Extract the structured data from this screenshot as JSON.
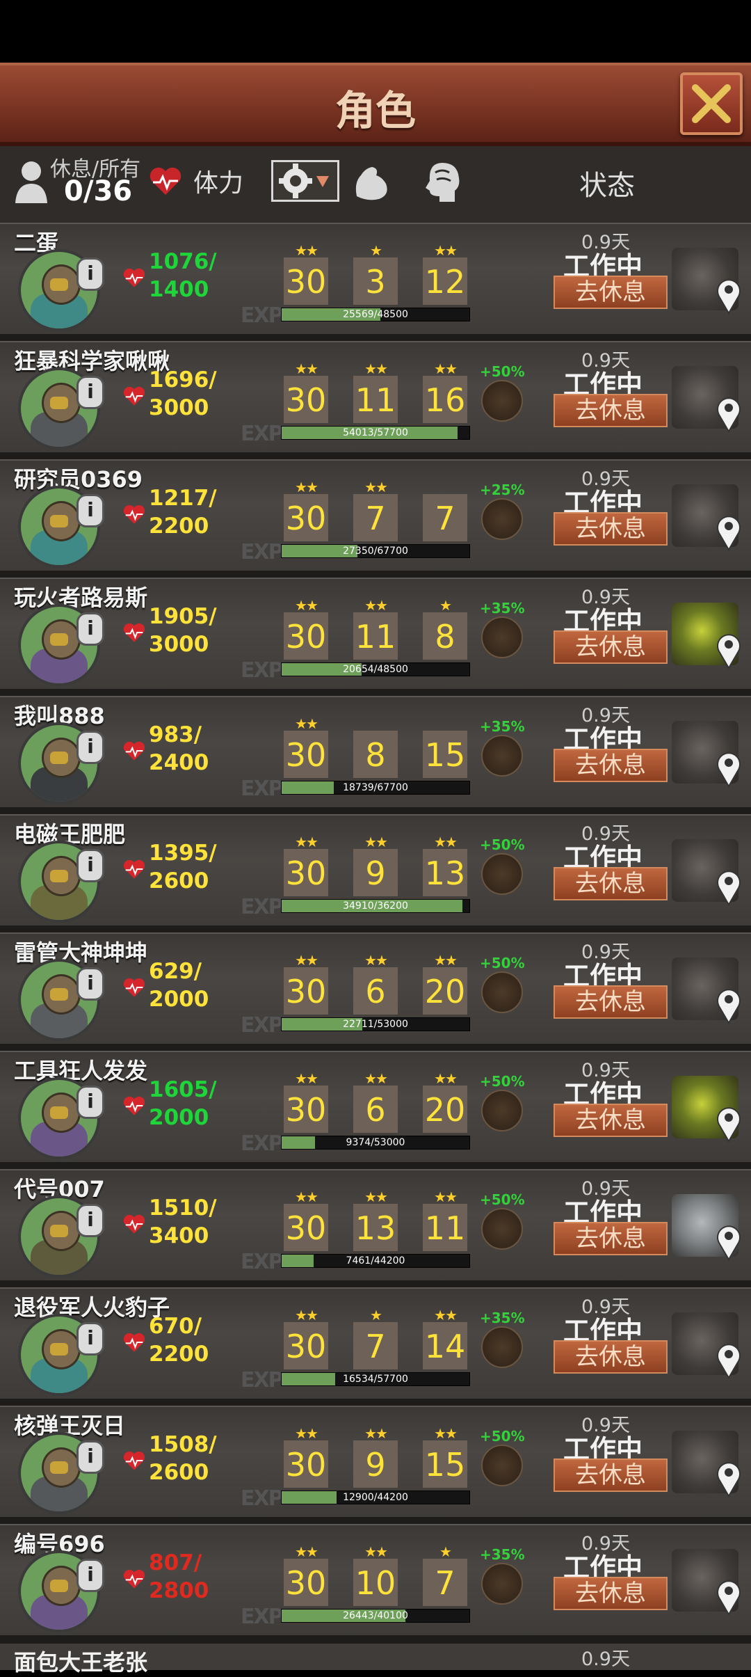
{
  "window": {
    "title": "角色",
    "close_icon": "close-icon"
  },
  "header": {
    "rest_label": "休息/所有",
    "rest_count": "0/36",
    "stamina_label": "体力",
    "status_label": "状态",
    "icons": [
      "person-icon",
      "heart-icon",
      "gear-sort-icon",
      "muscle-icon",
      "brain-icon"
    ]
  },
  "colors": {
    "hp_green": "#1fd63a",
    "hp_yellow": "#ffe23a",
    "hp_red": "#e02a1f",
    "exp_fill": "#6ea05a",
    "button": "#b5593a"
  },
  "characters": [
    {
      "name": "二蛋",
      "hp_cur": "1076/",
      "hp_max": "1400",
      "hp_color": "#1fd63a",
      "stat1": "30",
      "stat2": "3",
      "stat3": "12",
      "stars": [
        "★★",
        "★",
        "★★"
      ],
      "exp_text": "25569/48500",
      "exp_frac": 0.527,
      "bonus": "",
      "bonus_icon": "",
      "days": "0.9天",
      "status": "工作中",
      "action": "去休息",
      "machine": "machine-icon"
    },
    {
      "name": "狂暴科学家啾啾",
      "hp_cur": "1696/",
      "hp_max": "3000",
      "hp_color": "#ffe23a",
      "stat1": "30",
      "stat2": "11",
      "stat3": "16",
      "stars": [
        "★★",
        "★★",
        "★★"
      ],
      "exp_text": "54013/57700",
      "exp_frac": 0.936,
      "bonus": "+50%",
      "bonus_icon": "crystal-cluster-icon",
      "days": "0.9天",
      "status": "工作中",
      "action": "去休息",
      "machine": "machine-icon"
    },
    {
      "name": "研究员0369",
      "hp_cur": "1217/",
      "hp_max": "2200",
      "hp_color": "#ffe23a",
      "stat1": "30",
      "stat2": "7",
      "stat3": "7",
      "stars": [
        "★★",
        "★★",
        ""
      ],
      "exp_text": "27350/67700",
      "exp_frac": 0.404,
      "bonus": "+25%",
      "bonus_icon": "crystal-icon",
      "days": "0.9天",
      "status": "工作中",
      "action": "去休息",
      "machine": "machine-icon"
    },
    {
      "name": "玩火者路易斯",
      "hp_cur": "1905/",
      "hp_max": "3000",
      "hp_color": "#ffe23a",
      "stat1": "30",
      "stat2": "11",
      "stat3": "8",
      "stars": [
        "★★",
        "★★",
        "★"
      ],
      "exp_text": "20654/48500",
      "exp_frac": 0.426,
      "bonus": "+35%",
      "bonus_icon": "dynamite-icon",
      "days": "0.9天",
      "status": "工作中",
      "action": "去休息",
      "machine": "reactor-icon"
    },
    {
      "name": "我叫888",
      "hp_cur": "983/",
      "hp_max": "2400",
      "hp_color": "#ffe23a",
      "stat1": "30",
      "stat2": "8",
      "stat3": "15",
      "stars": [
        "★★",
        "",
        ""
      ],
      "exp_text": "18739/67700",
      "exp_frac": 0.277,
      "bonus": "+35%",
      "bonus_icon": "bottle-icon",
      "days": "0.9天",
      "status": "工作中",
      "action": "去休息",
      "machine": "machine-icon"
    },
    {
      "name": "电磁王肥肥",
      "hp_cur": "1395/",
      "hp_max": "2600",
      "hp_color": "#ffe23a",
      "stat1": "30",
      "stat2": "9",
      "stat3": "13",
      "stars": [
        "★★",
        "★★",
        "★★"
      ],
      "exp_text": "34910/36200",
      "exp_frac": 0.964,
      "bonus": "+50%",
      "bonus_icon": "orb-icon",
      "days": "0.9天",
      "status": "工作中",
      "action": "去休息",
      "machine": "machine-icon"
    },
    {
      "name": "雷管大神坤坤",
      "hp_cur": "629/",
      "hp_max": "2000",
      "hp_color": "#ffe23a",
      "stat1": "30",
      "stat2": "6",
      "stat3": "20",
      "stars": [
        "★★",
        "★★",
        "★★"
      ],
      "exp_text": "22711/53000",
      "exp_frac": 0.429,
      "bonus": "+50%",
      "bonus_icon": "detonator-icon",
      "days": "0.9天",
      "status": "工作中",
      "action": "去休息",
      "machine": "machine-icon"
    },
    {
      "name": "工具狂人发发",
      "hp_cur": "1605/",
      "hp_max": "2000",
      "hp_color": "#1fd63a",
      "stat1": "30",
      "stat2": "6",
      "stat3": "20",
      "stars": [
        "★★",
        "★★",
        "★★"
      ],
      "exp_text": "9374/53000",
      "exp_frac": 0.177,
      "bonus": "+50%",
      "bonus_icon": "tools-icon",
      "days": "0.9天",
      "status": "工作中",
      "action": "去休息",
      "machine": "generator-icon"
    },
    {
      "name": "代号007",
      "hp_cur": "1510/",
      "hp_max": "3400",
      "hp_color": "#ffe23a",
      "stat1": "30",
      "stat2": "13",
      "stat3": "11",
      "stars": [
        "★★",
        "★★",
        "★★"
      ],
      "exp_text": "7461/44200",
      "exp_frac": 0.169,
      "bonus": "+50%",
      "bonus_icon": "bullet-icon",
      "days": "0.9天",
      "status": "工作中",
      "action": "去休息",
      "machine": "tank-icon"
    },
    {
      "name": "退役军人火豹子",
      "hp_cur": "670/",
      "hp_max": "2200",
      "hp_color": "#ffe23a",
      "stat1": "30",
      "stat2": "7",
      "stat3": "14",
      "stars": [
        "★★",
        "★",
        "★★"
      ],
      "exp_text": "16534/57700",
      "exp_frac": 0.287,
      "bonus": "+35%",
      "bonus_icon": "shell-icon",
      "days": "0.9天",
      "status": "工作中",
      "action": "去休息",
      "machine": "machine-icon"
    },
    {
      "name": "核弹王灭日",
      "hp_cur": "1508/",
      "hp_max": "2600",
      "hp_color": "#ffe23a",
      "stat1": "30",
      "stat2": "9",
      "stat3": "15",
      "stars": [
        "★★",
        "★★",
        "★★"
      ],
      "exp_text": "12900/44200",
      "exp_frac": 0.292,
      "bonus": "+50%",
      "bonus_icon": "grenade-icon",
      "days": "0.9天",
      "status": "工作中",
      "action": "去休息",
      "machine": "machine-icon"
    },
    {
      "name": "编号696",
      "hp_cur": "807/",
      "hp_max": "2800",
      "hp_color": "#e02a1f",
      "stat1": "30",
      "stat2": "10",
      "stat3": "7",
      "stars": [
        "★★",
        "★★",
        "★"
      ],
      "exp_text": "26443/40100",
      "exp_frac": 0.659,
      "bonus": "+35%",
      "bonus_icon": "ammo-icon",
      "days": "0.9天",
      "status": "工作中",
      "action": "去休息",
      "machine": "machine-icon"
    }
  ],
  "partial": {
    "name": "面包大王老张",
    "days": "0.9天"
  }
}
